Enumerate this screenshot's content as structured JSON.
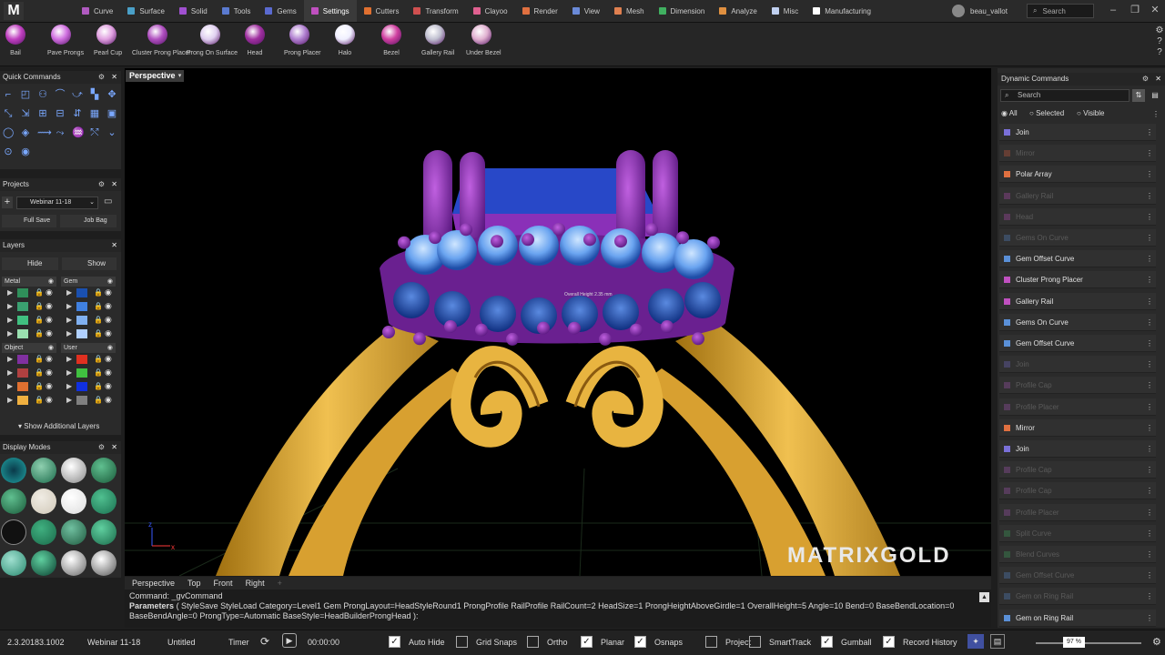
{
  "app": {
    "logo": "M"
  },
  "menu": {
    "tabs": [
      {
        "label": "Curve",
        "color": "#b05ac0"
      },
      {
        "label": "Surface",
        "color": "#4aa0c8"
      },
      {
        "label": "Solid",
        "color": "#a050d0"
      },
      {
        "label": "Tools",
        "color": "#5a7ad0"
      },
      {
        "label": "Gems",
        "color": "#5a6ad0"
      },
      {
        "label": "Settings",
        "color": "#c050c0"
      },
      {
        "label": "Cutters",
        "color": "#e07030"
      },
      {
        "label": "Transform",
        "color": "#d05050"
      },
      {
        "label": "Clayoo",
        "color": "#e06090"
      },
      {
        "label": "Render",
        "color": "#e07040"
      },
      {
        "label": "View",
        "color": "#6a8ad8"
      },
      {
        "label": "Mesh",
        "color": "#e08050"
      },
      {
        "label": "Dimension",
        "color": "#40b060"
      },
      {
        "label": "Analyze",
        "color": "#e09040"
      },
      {
        "label": "Misc",
        "color": "#c0d0f0"
      },
      {
        "label": "Manufacturing",
        "color": "#ffffff"
      }
    ],
    "active_tab": "Settings",
    "user": "beau_vallot",
    "search_placeholder": "Search"
  },
  "ribbon": {
    "tools": [
      {
        "label": "Bail",
        "icon": "bail-icon"
      },
      {
        "label": "Pave Prongs",
        "icon": "pave-prongs-icon"
      },
      {
        "label": "Pearl Cup",
        "icon": "pearl-cup-icon"
      },
      {
        "label": "Cluster Prong Placer",
        "icon": "cluster-prong-icon"
      },
      {
        "label": "Prong On Surface",
        "icon": "prong-on-surface-icon"
      },
      {
        "label": "Head",
        "icon": "head-icon"
      },
      {
        "label": "Prong Placer",
        "icon": "prong-placer-icon"
      },
      {
        "label": "Halo",
        "icon": "halo-icon"
      },
      {
        "label": "Bezel",
        "icon": "bezel-icon"
      },
      {
        "label": "Gallery Rail",
        "icon": "gallery-rail-icon"
      },
      {
        "label": "Under Bezel",
        "icon": "under-bezel-icon"
      }
    ]
  },
  "quick_commands": {
    "title": "Quick Commands"
  },
  "projects": {
    "title": "Projects",
    "project": "Webinar 11-18",
    "full_save": "Full Save",
    "job_bag": "Job Bag"
  },
  "layers": {
    "title": "Layers",
    "hide": "Hide",
    "show": "Show",
    "groups": [
      {
        "name": "Metal",
        "colors": [
          "#2f8f5a",
          "#3aa070",
          "#40c080",
          "#9ae0b0"
        ]
      },
      {
        "name": "Gem",
        "colors": [
          "#1a50b0",
          "#4080e0",
          "#80b0f0",
          "#b0d0ff"
        ]
      },
      {
        "name": "Object",
        "colors": [
          "#8030a0",
          "#b04040",
          "#e07030",
          "#f0b040"
        ]
      },
      {
        "name": "User",
        "colors": [
          "#e03020",
          "#40c040",
          "#1030e0",
          "#808080"
        ]
      }
    ],
    "show_additional": "Show Additional Layers"
  },
  "display_modes": {
    "title": "Display Modes"
  },
  "viewport": {
    "label": "Perspective",
    "tabs": [
      "Perspective",
      "Top",
      "Front",
      "Right"
    ],
    "annotation": "Overall Height 2.35 mm",
    "watermark": "MATRIXGOLD"
  },
  "command_line": {
    "line1": "Command: _gvCommand",
    "params_label": "Parameters",
    "params_text": "( StyleSave StyleLoad Category=Level1 Gem ProngLayout=HeadStyleRound1 ProngProfile RailProfile RailCount=2 HeadSize=1 ProngHeightAboveGirdle=1 OverallHeight=5 Angle=10 Bend=0 BaseBendLocation=0 BaseBendAngle=0 ProngType=Automatic BaseStyle=HeadBuilderProngHead ):"
  },
  "dynamic_commands": {
    "title": "Dynamic Commands",
    "search_placeholder": "Search",
    "filters": [
      "All",
      "Selected",
      "Visible"
    ],
    "items": [
      {
        "label": "Join",
        "color": "#7a70d8",
        "enabled": true
      },
      {
        "label": "Mirror",
        "color": "#e06040",
        "enabled": false
      },
      {
        "label": "Polar Array",
        "color": "#e07040",
        "enabled": true
      },
      {
        "label": "Gallery Rail",
        "color": "#c050c0",
        "enabled": false
      },
      {
        "label": "Head",
        "color": "#c050c0",
        "enabled": false
      },
      {
        "label": "Gems On Curve",
        "color": "#5a90d8",
        "enabled": false
      },
      {
        "label": "Gem Offset Curve",
        "color": "#5a90d8",
        "enabled": true
      },
      {
        "label": "Cluster Prong Placer",
        "color": "#c050c0",
        "enabled": true
      },
      {
        "label": "Gallery Rail",
        "color": "#c050c0",
        "enabled": true
      },
      {
        "label": "Gems On Curve",
        "color": "#5a90d8",
        "enabled": true
      },
      {
        "label": "Gem Offset Curve",
        "color": "#5a90d8",
        "enabled": true
      },
      {
        "label": "Join",
        "color": "#7a70d8",
        "enabled": false
      },
      {
        "label": "Profile Cap",
        "color": "#b05ac0",
        "enabled": false
      },
      {
        "label": "Profile Placer",
        "color": "#b05ac0",
        "enabled": false
      },
      {
        "label": "Mirror",
        "color": "#e07040",
        "enabled": true
      },
      {
        "label": "Join",
        "color": "#7a70d8",
        "enabled": true
      },
      {
        "label": "Profile Cap",
        "color": "#b05ac0",
        "enabled": false
      },
      {
        "label": "Profile Cap",
        "color": "#b05ac0",
        "enabled": false
      },
      {
        "label": "Profile Placer",
        "color": "#b05ac0",
        "enabled": false
      },
      {
        "label": "Split Curve",
        "color": "#40b060",
        "enabled": false
      },
      {
        "label": "Blend Curves",
        "color": "#40b060",
        "enabled": false
      },
      {
        "label": "Gem Offset Curve",
        "color": "#5a90d8",
        "enabled": false
      },
      {
        "label": "Gem on Ring Rail",
        "color": "#5a90d8",
        "enabled": false
      },
      {
        "label": "Gem on Ring Rail",
        "color": "#5a90d8",
        "enabled": true
      }
    ]
  },
  "status": {
    "version": "2.3.20183.1002",
    "project": "Webinar 11-18",
    "file": "Untitled",
    "timer_label": "Timer",
    "time": "00:00:00",
    "toggles": [
      {
        "label": "Auto Hide",
        "checked": true
      },
      {
        "label": "Grid Snaps",
        "checked": false
      },
      {
        "label": "Ortho",
        "checked": false
      },
      {
        "label": "Planar",
        "checked": true
      },
      {
        "label": "Osnaps",
        "checked": true
      },
      {
        "label": "Project",
        "checked": false
      },
      {
        "label": "SmartTrack",
        "checked": false
      },
      {
        "label": "Gumball",
        "checked": true
      },
      {
        "label": "Record History",
        "checked": true
      }
    ],
    "zoom": "97 %"
  }
}
